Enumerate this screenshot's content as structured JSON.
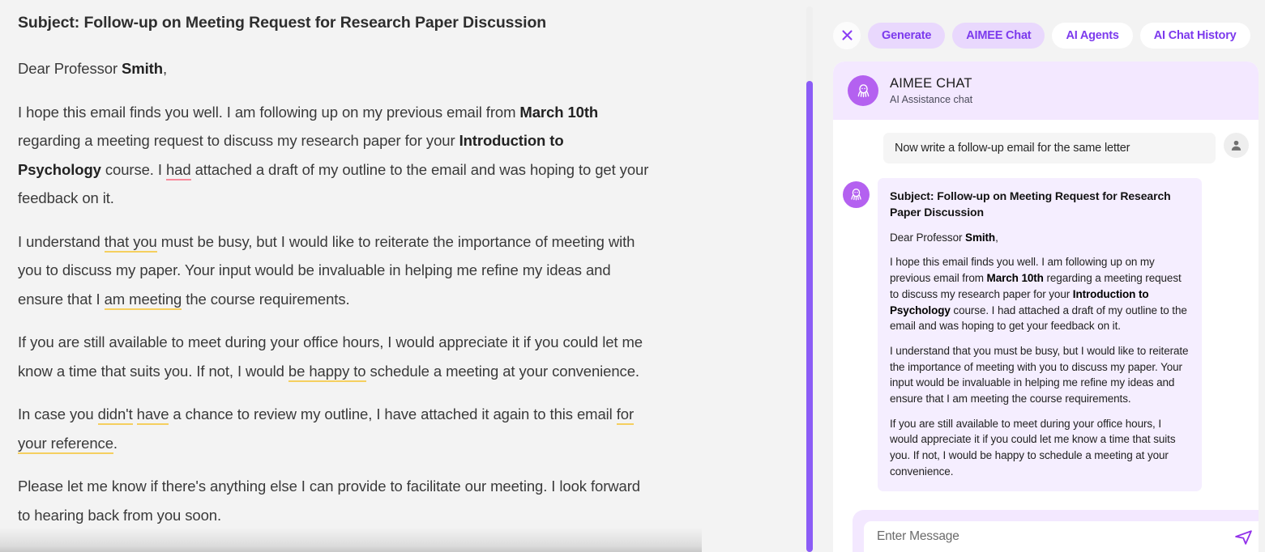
{
  "document": {
    "title": "Subject: Follow-up on Meeting Request for Research Paper Discussion",
    "salutation_pre": "Dear Professor ",
    "salutation_name": "Smith",
    "salutation_post": ",",
    "p1": {
      "a": "I hope this email finds you well. I am following up on my previous email from ",
      "b1": "March 10th",
      "c": " regarding a meeting request to discuss my research paper for your ",
      "b2": "Introduction to Psychology",
      "d": " course. I ",
      "u1": "had",
      "e": " attached a draft of my outline to the email and was hoping to get your feedback on it."
    },
    "p2": {
      "a": "I understand ",
      "u1": "that you",
      "b": " must be busy, but I would like to reiterate the importance of meeting with you to discuss my paper. Your input would be invaluable in helping me refine my ideas and ensure that I ",
      "u2": "am meeting",
      "c": " the course requirements."
    },
    "p3": {
      "a": "If you are still available to meet during your office hours, I would appreciate it if you could let me know a time that suits you. If not, I would ",
      "u1": "be happy to",
      "b": " schedule a meeting at your convenience."
    },
    "p4": {
      "a": "In case you ",
      "u1": "didn't",
      "b": " ",
      "u2": "have",
      "c": " a chance to review my outline, I have attached it again to this email ",
      "u3": "for your reference",
      "d": "."
    },
    "p5": "Please let me know if there's anything else I can provide to facilitate our meeting. I look forward to hearing back from you soon."
  },
  "chat": {
    "close_label": "close-icon",
    "tabs": [
      {
        "label": "Generate",
        "active": true
      },
      {
        "label": "AIMEE Chat",
        "active": true
      },
      {
        "label": "AI Agents",
        "active": false
      },
      {
        "label": "AI Chat History",
        "active": false
      }
    ],
    "header": {
      "title": "AIMEE CHAT",
      "subtitle": "AI Assistance chat"
    },
    "user_message": "Now write a follow-up email for the same letter",
    "ai_message": {
      "title": "Subject: Follow-up on Meeting Request for Research Paper Discussion",
      "salutation_pre": "Dear Professor ",
      "salutation_name": "Smith",
      "salutation_post": ",",
      "p1": {
        "a": "I hope this email finds you well. I am following up on my previous email from ",
        "b1": "March 10th",
        "c": " regarding a meeting request to discuss my research paper for your ",
        "b2": "Introduction to Psychology",
        "d": " course. I had attached a draft of my outline to the email and was hoping to get your feedback on it."
      },
      "p2": "I understand that you must be busy, but I would like to reiterate the importance of meeting with you to discuss my paper. Your input would be invaluable in helping me refine my ideas and ensure that I am meeting the course requirements.",
      "p3": "If you are still available to meet during your office hours, I would appreciate it if you could let me know a time that suits you. If not, I would be happy to schedule a meeting at your convenience."
    },
    "input": {
      "value": "",
      "placeholder": "Enter Message"
    },
    "send_label": "send-icon"
  },
  "colors": {
    "accent_purple": "#8b5cf6",
    "avatar_purple": "#b461f0",
    "tab_active_bg": "#e9d8fd",
    "ai_bubble_bg": "#f5eeff",
    "header_bg": "#f3e8ff",
    "grammar_underline": "#f98a9c",
    "style_underline": "#f5cf5f"
  }
}
